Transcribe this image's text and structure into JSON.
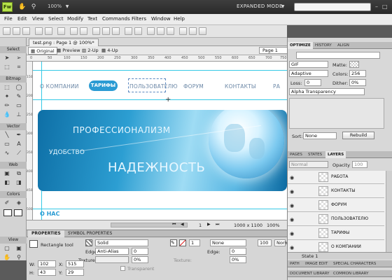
{
  "title_bar": {
    "logo": "Fw",
    "zoom": "100%",
    "mode": "EXPANDED MODE"
  },
  "menu": [
    "File",
    "Edit",
    "View",
    "Select",
    "Modify",
    "Text",
    "Commands",
    "Filters",
    "Window",
    "Help"
  ],
  "tools": {
    "sections": [
      "Select",
      "Bitmap",
      "Vector",
      "Web",
      "Colors",
      "View"
    ]
  },
  "document": {
    "tab": "test.png : Page 1 @ 100%*",
    "views": [
      "Original",
      "Preview",
      "2-Up",
      "4-Up"
    ],
    "page": "Page 1"
  },
  "ruler": {
    "top": [
      "0",
      "50",
      "100",
      "150",
      "200",
      "250",
      "300",
      "350",
      "400",
      "450",
      "500",
      "550",
      "600",
      "650",
      "700",
      "750"
    ],
    "left": [
      "150",
      "200",
      "250",
      "300",
      "350",
      "400",
      "450",
      "500"
    ]
  },
  "canvas": {
    "nav": [
      "О КОМПАНИИ",
      "ТАРИФЫ",
      "ПОЛЬЗОВАТЕЛЮ",
      "ФОРУМ",
      "КОНТАКТЫ",
      "РА"
    ],
    "banner": {
      "line1": "ПРОФЕССИОНАЛИЗМ",
      "line2": "УДОБСТВО",
      "line3": "НАДЕЖНОСТЬ"
    },
    "footer_text": "О НАС"
  },
  "status": {
    "page": "1",
    "size": "1000 x 1100",
    "zoom": "100%"
  },
  "properties": {
    "tabs": [
      "PROPERTIES",
      "SYMBOL PROPERTIES"
    ],
    "tool_name": "Rectangle tool",
    "fill": "Solid",
    "edge_label": "Edge:",
    "edge": "Anti-Alias",
    "edge_val": "0",
    "texture_label": "Texture:",
    "texture_val": "0%",
    "transparent": "Transparent",
    "stroke_val": "1",
    "stroke_type": "None",
    "stroke_edge": "Edge:",
    "stroke_edge_val": "0",
    "stroke_texture": "Texture:",
    "stroke_texture_val": "0%",
    "opacity": "100",
    "blend": "Normal",
    "w_label": "W:",
    "w": "102",
    "x_label": "X:",
    "x": "515",
    "h_label": "H:",
    "h": "43",
    "y_label": "Y:",
    "y": "29"
  },
  "optimize": {
    "tabs": [
      "OPTIMIZE",
      "HISTORY",
      "ALIGN"
    ],
    "format": "GIF",
    "matte": "Matte:",
    "palette": "Adaptive",
    "colors_label": "Colors:",
    "colors": "256",
    "loss_label": "Loss:",
    "loss": "0",
    "dither_label": "Dither:",
    "dither": "0%",
    "transparency": "Alpha Transparency",
    "sort_label": "Sort:",
    "sort": "None",
    "rebuild": "Rebuild"
  },
  "layers": {
    "tabs": [
      "PAGES",
      "STATES",
      "LAYERS"
    ],
    "blend": "Normal",
    "opacity_label": "Opacity",
    "opacity": "100",
    "items": [
      "РАБОТА",
      "КОНТАКТЫ",
      "ФОРУМ",
      "ПОЛЬЗОВАТЕЛЮ",
      "ТАРИФЫ",
      "О КОМПАНИИ"
    ],
    "state": "State 1"
  },
  "bottom_tabs": [
    "PATH",
    "IMAGE EDIT",
    "SPECIAL CHARACTERS"
  ],
  "library_tabs": [
    "DOCUMENT LIBRARY",
    "COMMON LIBRARY"
  ]
}
